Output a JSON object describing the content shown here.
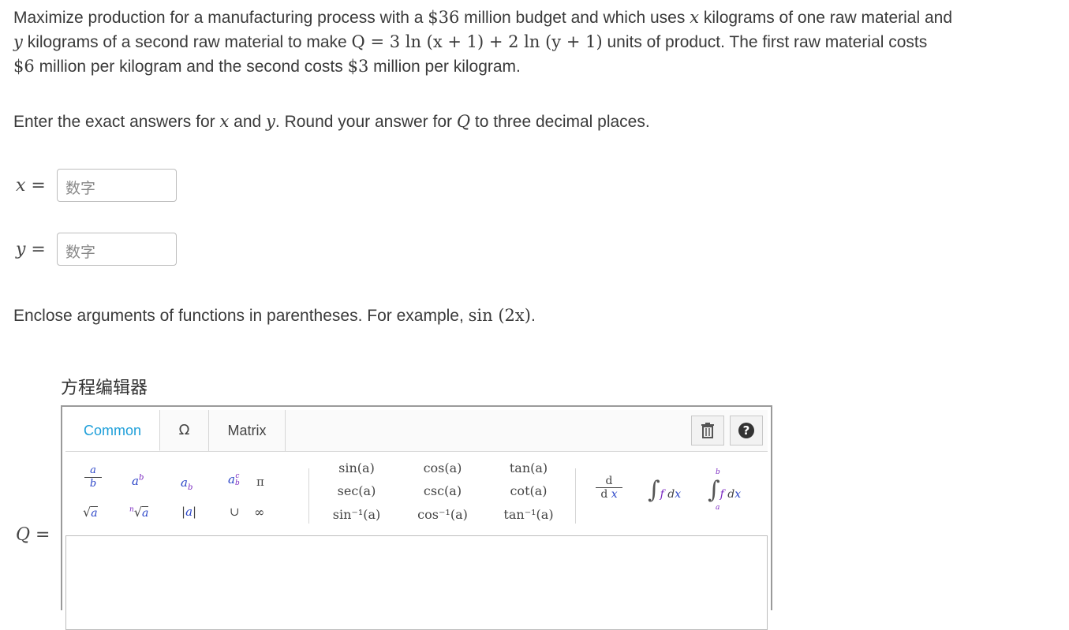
{
  "problem": {
    "line1_a": "Maximize production for a manufacturing process with a ",
    "budget": "$36",
    "line1_b": " million budget and which uses ",
    "var_x": "x",
    "line1_c": " kilograms of one raw material and",
    "var_y": "y",
    "line2_a": " kilograms of a second raw material to make ",
    "formula": "Q = 3 ln (x + 1) + 2 ln (y + 1)",
    "line2_b": " units of product. The first raw material costs",
    "cost1": "$6",
    "line3_a": " million per kilogram and the second costs ",
    "cost2": "$3",
    "line3_b": " million per kilogram."
  },
  "instructions": {
    "a": "Enter the exact answers for ",
    "x": "x",
    "b": " and ",
    "y": "y",
    "c": ". Round your answer for ",
    "q": "Q",
    "d": " to three decimal places."
  },
  "fields": {
    "x_label": "x =",
    "y_label": "y =",
    "q_label": "Q =",
    "placeholder": "数字"
  },
  "enclose_note": {
    "text": "Enclose arguments of functions in parentheses. For example, ",
    "example": "sin (2x)",
    "end": "."
  },
  "editor": {
    "title": "方程编辑器",
    "tabs": [
      "Common",
      "Ω",
      "Matrix"
    ],
    "delete_icon": "trash-icon",
    "help_icon": "question-icon",
    "palette": {
      "pi": "π",
      "union": "∪",
      "infinity": "∞",
      "abs": "|a|",
      "trig": [
        "sin(a)",
        "cos(a)",
        "tan(a)",
        "sec(a)",
        "csc(a)",
        "cot(a)",
        "sin⁻¹(a)",
        "cos⁻¹(a)",
        "tan⁻¹(a)"
      ]
    }
  },
  "colors": {
    "accent_tab": "#1e9fd9",
    "variable_blue": "#2b45c8",
    "variable_purple": "#7a28c0"
  }
}
